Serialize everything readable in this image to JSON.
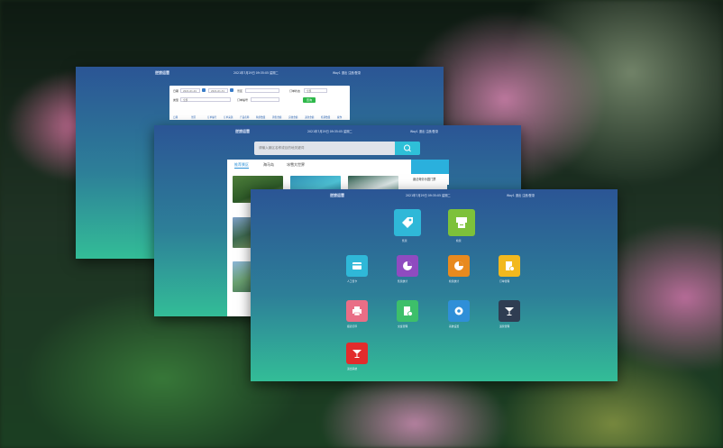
{
  "background": {
    "subject": "pink-flowers-photo"
  },
  "windows": {
    "w1": {
      "logo": "逆旅运营",
      "datetime": "2021年7月29日 09:35:05 星期二",
      "user": "Way1  退出  注册/登录",
      "form": {
        "date_label": "日期",
        "date_from": "2021-01-01",
        "date_to": "2021-01-31",
        "scenic_label": "景区",
        "scenic_value": "全部",
        "status_label": "订单状态",
        "status_value": "全部",
        "type_label": "类型",
        "type_value": "全部",
        "order_label": "订单编号",
        "query_button": "查询"
      },
      "columns": [
        "日期",
        "景区",
        "订单编号",
        "订单来源",
        "产品名称",
        "购票数量",
        "销售金额",
        "实收金额",
        "退款金额",
        "核销数量",
        "操作"
      ]
    },
    "w2": {
      "logo": "逆旅运营",
      "datetime": "2021年7月29日 09:35:05 星期二",
      "user": "Way1  退出  注册/登录",
      "search_placeholder": "请输入景区名称或目的地关键词",
      "tabs": [
        "推荐景区",
        "海马岛",
        "冰雪大世界"
      ],
      "side_card_text": "魔法奇妙乐园门票"
    },
    "w3": {
      "logo": "逆旅运营",
      "datetime": "2021年7月29日 09:35:05 星期二",
      "user": "Way1  退出  注册/登录",
      "tiles": [
        {
          "label": "售票",
          "icon": "ticket-tag-icon",
          "color": "#2fb8d8"
        },
        {
          "label": "检票",
          "icon": "ticket-machine-icon",
          "color": "#7dc13a"
        },
        {
          "label": "人工售卡",
          "icon": "card-icon",
          "color": "#2fb8d8"
        },
        {
          "label": "售票统计",
          "icon": "pie-chart-icon",
          "color": "#8f4bc0"
        },
        {
          "label": "检票统计",
          "icon": "pie-chart-icon",
          "color": "#e88a1e"
        },
        {
          "label": "订单管理",
          "icon": "document-clock-icon",
          "color": "#f2b81e"
        },
        {
          "label": "报表打印",
          "icon": "printer-icon",
          "color": "#e96e86"
        },
        {
          "label": "交班管理",
          "icon": "document-gear-icon",
          "color": "#3dbf6a"
        },
        {
          "label": "系统设置",
          "icon": "gear-icon",
          "color": "#2f8fd8"
        },
        {
          "label": "退票管理",
          "icon": "cocktail-icon",
          "color": "#2f3d52"
        },
        {
          "label": "退出系统",
          "icon": "cocktail-icon",
          "color": "#e22c2c"
        }
      ]
    }
  }
}
